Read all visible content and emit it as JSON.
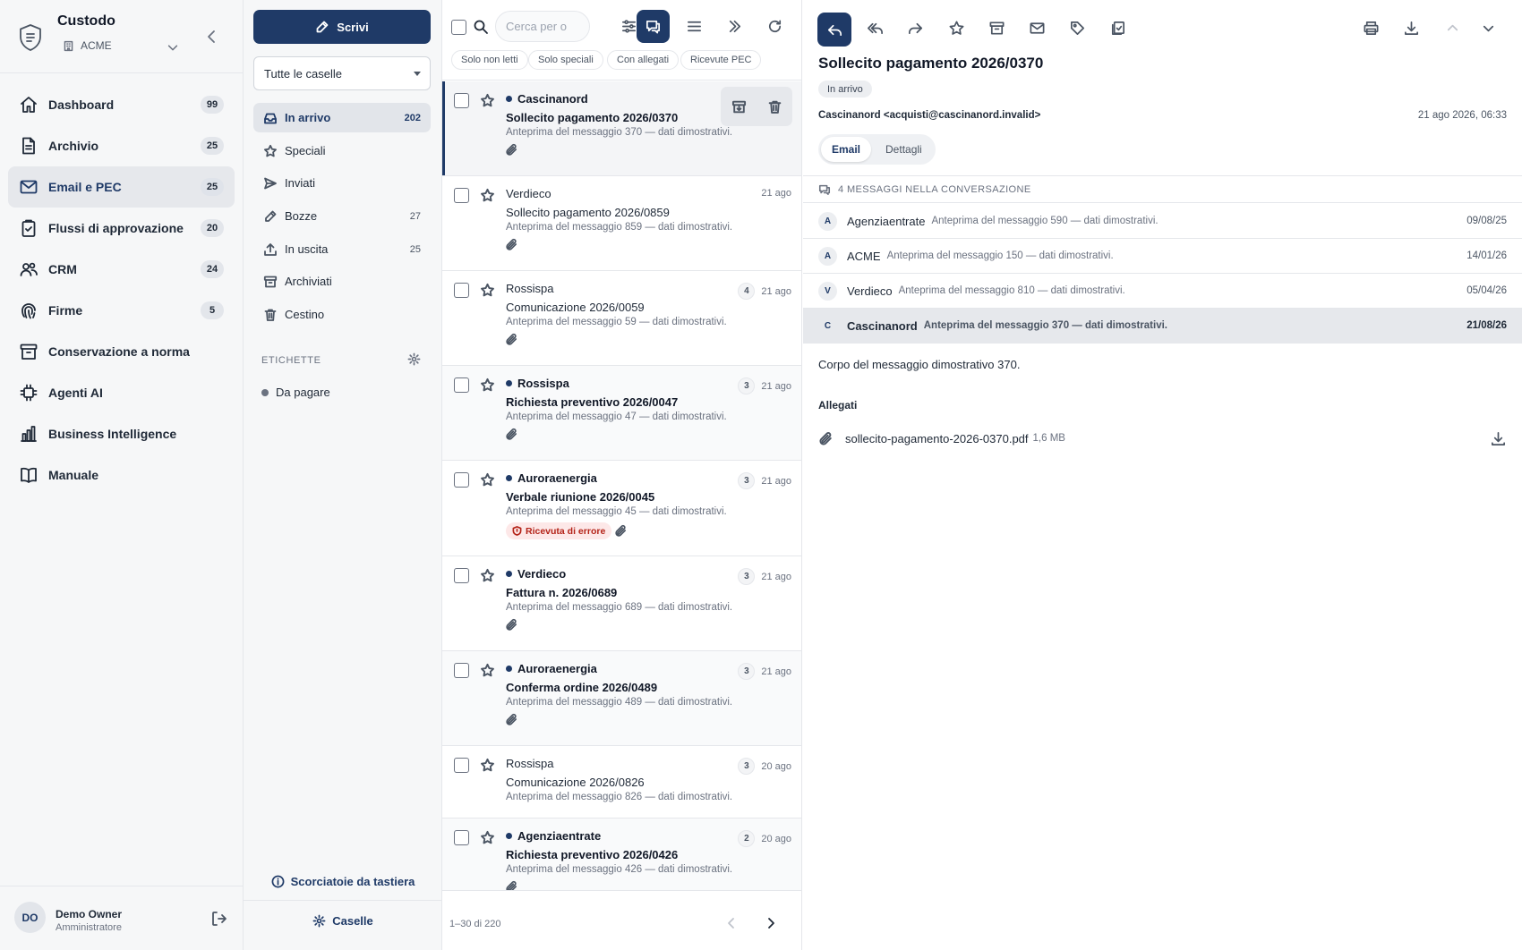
{
  "app": {
    "name": "Custodo",
    "org": "ACME",
    "colors": {
      "accent": "#1f3a67",
      "error": "#b42318",
      "sidebar_bg": "#f6f7f8"
    }
  },
  "nav": [
    {
      "label": "Dashboard",
      "badge": "99",
      "icon": "home-icon"
    },
    {
      "label": "Archivio",
      "badge": "25",
      "icon": "document-icon"
    },
    {
      "label": "Email e PEC",
      "badge": "25",
      "icon": "mail-icon",
      "active": true
    },
    {
      "label": "Flussi di approvazione",
      "badge": "20",
      "icon": "clipboard-check-icon"
    },
    {
      "label": "CRM",
      "badge": "24",
      "icon": "users-icon"
    },
    {
      "label": "Firme",
      "badge": "5",
      "icon": "fingerprint-icon"
    },
    {
      "label": "Conservazione a norma",
      "badge": "",
      "icon": "archive-box-icon"
    },
    {
      "label": "Agenti AI",
      "badge": "",
      "icon": "chip-icon"
    },
    {
      "label": "Business Intelligence",
      "badge": "",
      "icon": "bar-chart-icon"
    },
    {
      "label": "Manuale",
      "badge": "",
      "icon": "book-icon"
    }
  ],
  "user": {
    "initials": "DO",
    "name": "Demo Owner",
    "role": "Amministratore"
  },
  "mailbox": {
    "compose_label": "Scrivi",
    "selector_value": "Tutte le caselle",
    "folders": [
      {
        "label": "In arrivo",
        "count": "202",
        "icon": "inbox-icon",
        "active": true
      },
      {
        "label": "Speciali",
        "count": "",
        "icon": "star-icon"
      },
      {
        "label": "Inviati",
        "count": "",
        "icon": "send-icon"
      },
      {
        "label": "Bozze",
        "count": "27",
        "icon": "pencil-icon"
      },
      {
        "label": "In uscita",
        "count": "25",
        "icon": "upload-icon"
      },
      {
        "label": "Archiviati",
        "count": "",
        "icon": "archive-icon"
      },
      {
        "label": "Cestino",
        "count": "",
        "icon": "trash-icon"
      }
    ],
    "labels_title": "ETICHETTE",
    "labels": [
      {
        "label": "Da pagare"
      }
    ],
    "shortcuts_label": "Scorciatoie da tastiera",
    "caselle_label": "Caselle"
  },
  "list": {
    "search_placeholder": "Cerca per o",
    "filters": [
      "Solo non letti",
      "Solo speciali",
      "Con allegati",
      "Ricevute PEC"
    ],
    "messages": [
      {
        "sender": "Cascinanord",
        "subject": "Sollecito pagamento 2026/0370",
        "preview": "Anteprima del messaggio 370 — dati dimostrativi.",
        "date": "",
        "count": "",
        "unread": true,
        "selected": true,
        "attachment": true
      },
      {
        "sender": "Verdieco",
        "subject": "Sollecito pagamento 2026/0859",
        "preview": "Anteprima del messaggio 859 — dati dimostrativi.",
        "date": "21 ago",
        "count": "",
        "unread": false,
        "attachment": true
      },
      {
        "sender": "Rossispa",
        "subject": "Comunicazione 2026/0059",
        "preview": "Anteprima del messaggio 59 — dati dimostrativi.",
        "date": "21 ago",
        "count": "4",
        "unread": false,
        "attachment": true
      },
      {
        "sender": "Rossispa",
        "subject": "Richiesta preventivo 2026/0047",
        "preview": "Anteprima del messaggio 47 — dati dimostrativi.",
        "date": "21 ago",
        "count": "3",
        "unread": true,
        "attachment": true
      },
      {
        "sender": "Auroraenergia",
        "subject": "Verbale riunione 2026/0045",
        "preview": "Anteprima del messaggio 45 — dati dimostrativi.",
        "date": "21 ago",
        "count": "3",
        "unread": true,
        "attachment": true,
        "badge": "Ricevuta di errore"
      },
      {
        "sender": "Verdieco",
        "subject": "Fattura n. 2026/0689",
        "preview": "Anteprima del messaggio 689 — dati dimostrativi.",
        "date": "21 ago",
        "count": "3",
        "unread": true,
        "attachment": true
      },
      {
        "sender": "Auroraenergia",
        "subject": "Conferma ordine 2026/0489",
        "preview": "Anteprima del messaggio 489 — dati dimostrativi.",
        "date": "21 ago",
        "count": "3",
        "unread": true,
        "attachment": true
      },
      {
        "sender": "Rossispa",
        "subject": "Comunicazione 2026/0826",
        "preview": "Anteprima del messaggio 826 — dati dimostrativi.",
        "date": "20 ago",
        "count": "3",
        "unread": false,
        "attachment": false
      },
      {
        "sender": "Agenziaentrate",
        "subject": "Richiesta preventivo 2026/0426",
        "preview": "Anteprima del messaggio 426 — dati dimostrativi.",
        "date": "20 ago",
        "count": "2",
        "unread": true,
        "attachment": true
      }
    ],
    "pagination": "1–30 di 220"
  },
  "reader": {
    "subject": "Sollecito pagamento 2026/0370",
    "folder_badge": "In arrivo",
    "from": "Cascinanord <acquisti@cascinanord.invalid>",
    "date": "21 ago 2026, 06:33",
    "tabs": [
      "Email",
      "Dettagli"
    ],
    "conversation_title": "4 MESSAGGI NELLA CONVERSAZIONE",
    "conversation": [
      {
        "initial": "A",
        "sender": "Agenziaentrate",
        "preview": "Anteprima del messaggio 590 — dati dimostrativi.",
        "date": "09/08/25"
      },
      {
        "initial": "A",
        "sender": "ACME",
        "preview": "Anteprima del messaggio 150 — dati dimostrativi.",
        "date": "14/01/26"
      },
      {
        "initial": "V",
        "sender": "Verdieco",
        "preview": "Anteprima del messaggio 810 — dati dimostrativi.",
        "date": "05/04/26"
      },
      {
        "initial": "C",
        "sender": "Cascinanord",
        "preview": "Anteprima del messaggio 370 — dati dimostrativi.",
        "date": "21/08/26",
        "current": true
      }
    ],
    "body": "Corpo del messaggio dimostrativo 370.",
    "attachments_title": "Allegati",
    "attachment": {
      "name": "sollecito-pagamento-2026-0370.pdf",
      "size": "1,6 MB"
    }
  }
}
